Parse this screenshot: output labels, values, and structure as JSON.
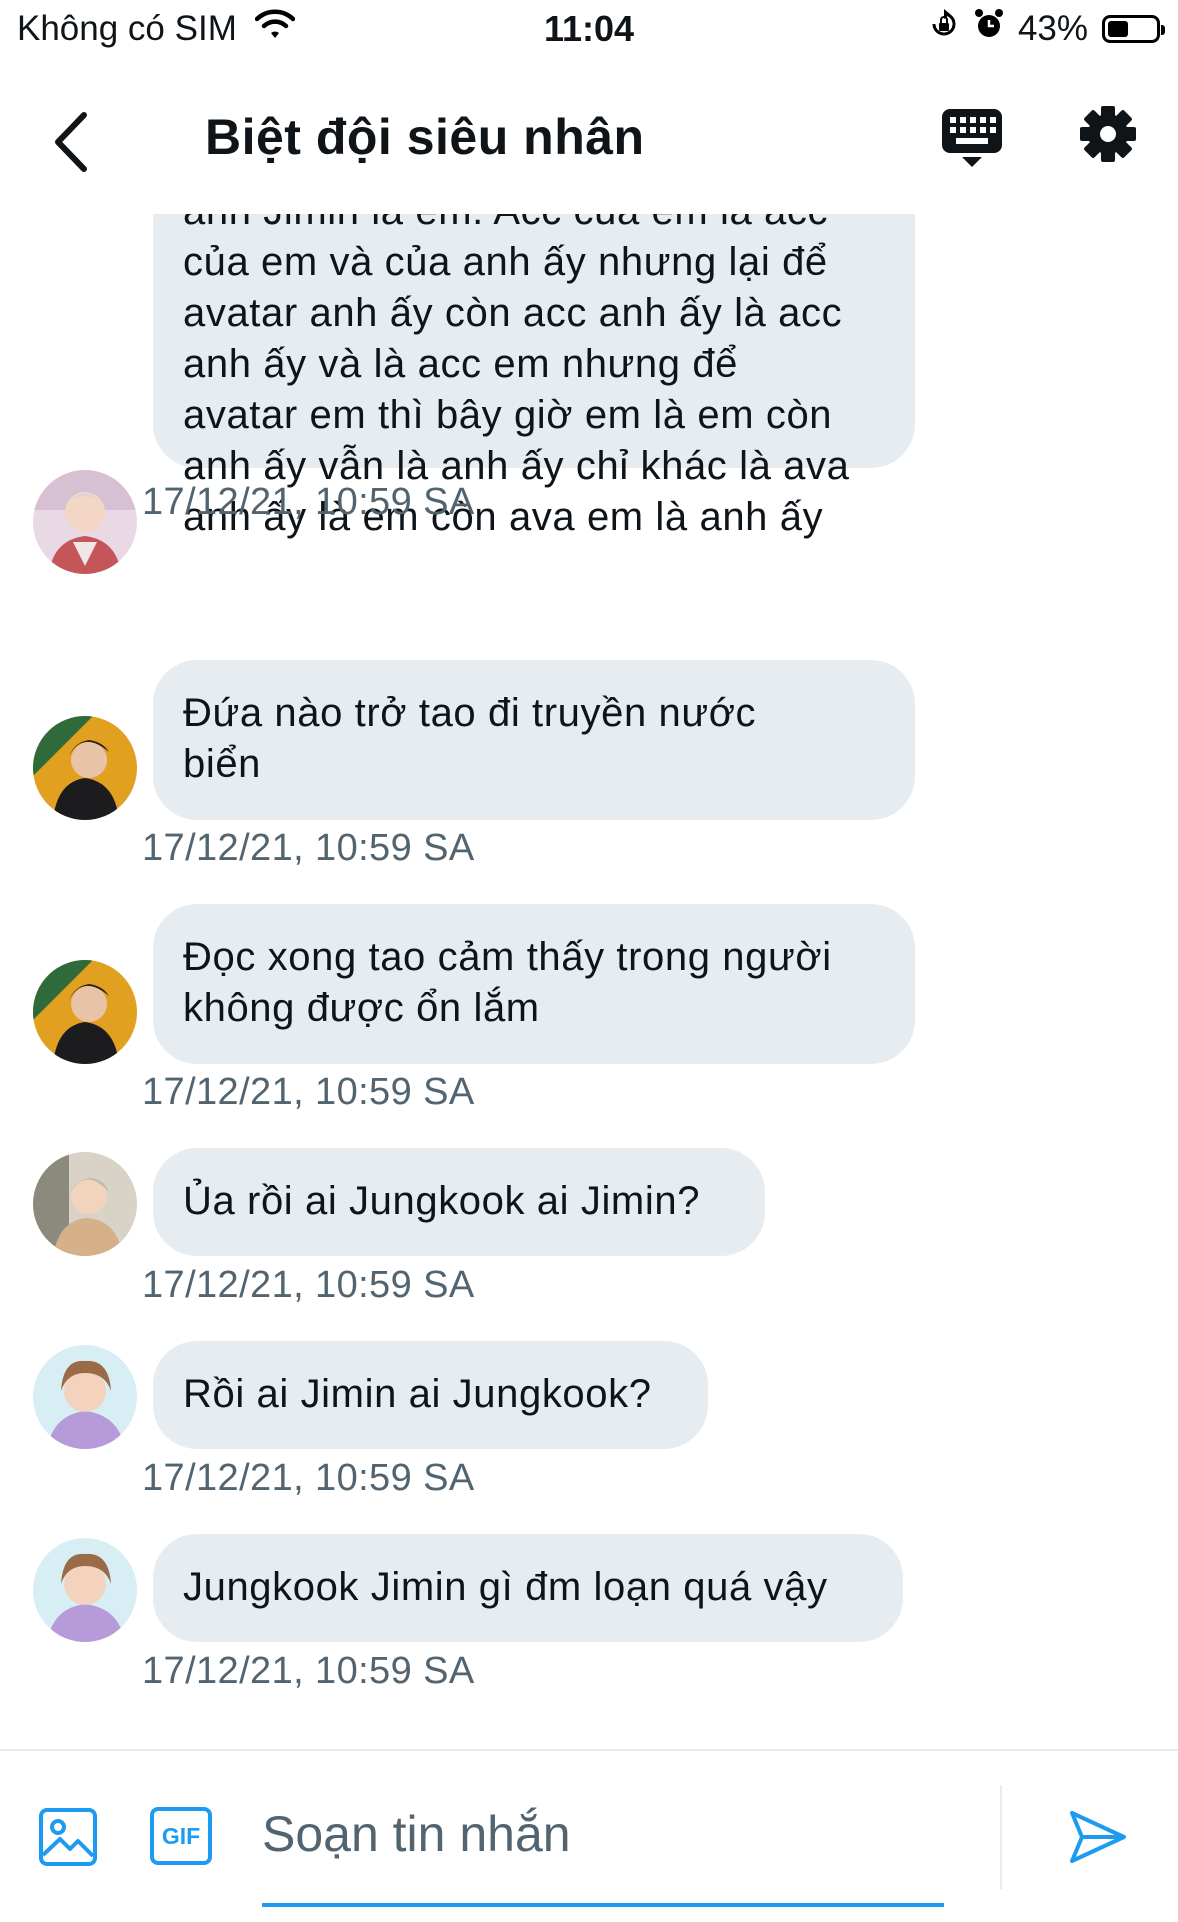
{
  "status_bar": {
    "carrier": "Không có SIM",
    "time": "11:04",
    "battery": "43%",
    "battery_level": 0.43,
    "icons": [
      "wifi-icon",
      "orientation-lock-icon",
      "alarm-icon",
      "battery-icon"
    ]
  },
  "header": {
    "title": "Biệt đội siêu nhân",
    "icons": [
      "back-chevron-icon",
      "keyboard-icon",
      "gear-icon"
    ]
  },
  "messages": [
    {
      "avatar": "avatar-a",
      "text": "anh Jimin là em. Acc của em là acc\ncủa em và của anh ấy nhưng lại để\navatar anh ấy còn acc anh ấy là acc\nanh ấy và là acc em nhưng để\navatar em thì bây giờ em là em còn\nanh ấy vẫn là anh ấy chỉ khác là ava\nanh ấy là em còn ava em là anh ấy",
      "time": "17/12/21, 10:59 SA"
    },
    {
      "avatar": "avatar-b",
      "text": "Đứa nào trở tao đi truyền nước\nbiển",
      "time": "17/12/21, 10:59 SA"
    },
    {
      "avatar": "avatar-b",
      "text": "Đọc xong tao cảm thấy trong người\nkhông được ổn lắm",
      "time": "17/12/21, 10:59 SA"
    },
    {
      "avatar": "avatar-c",
      "text": "Ủa rồi ai Jungkook ai Jimin?",
      "time": "17/12/21, 10:59 SA"
    },
    {
      "avatar": "avatar-d",
      "text": "Rồi ai Jimin ai Jungkook?",
      "time": "17/12/21, 10:59 SA"
    },
    {
      "avatar": "avatar-d",
      "text": "Jungkook Jimin gì đm loạn quá vậy",
      "time": "17/12/21, 10:59 SA"
    }
  ],
  "composer": {
    "placeholder": "Soạn tin nhắn",
    "value": "",
    "gif_label": "GIF",
    "icons": [
      "image-icon",
      "gif-icon",
      "send-icon"
    ]
  },
  "colors": {
    "accent": "#1d9bf0",
    "bubble": "#e6ecf0",
    "timestamp": "#536471",
    "text": "#0f1419"
  }
}
